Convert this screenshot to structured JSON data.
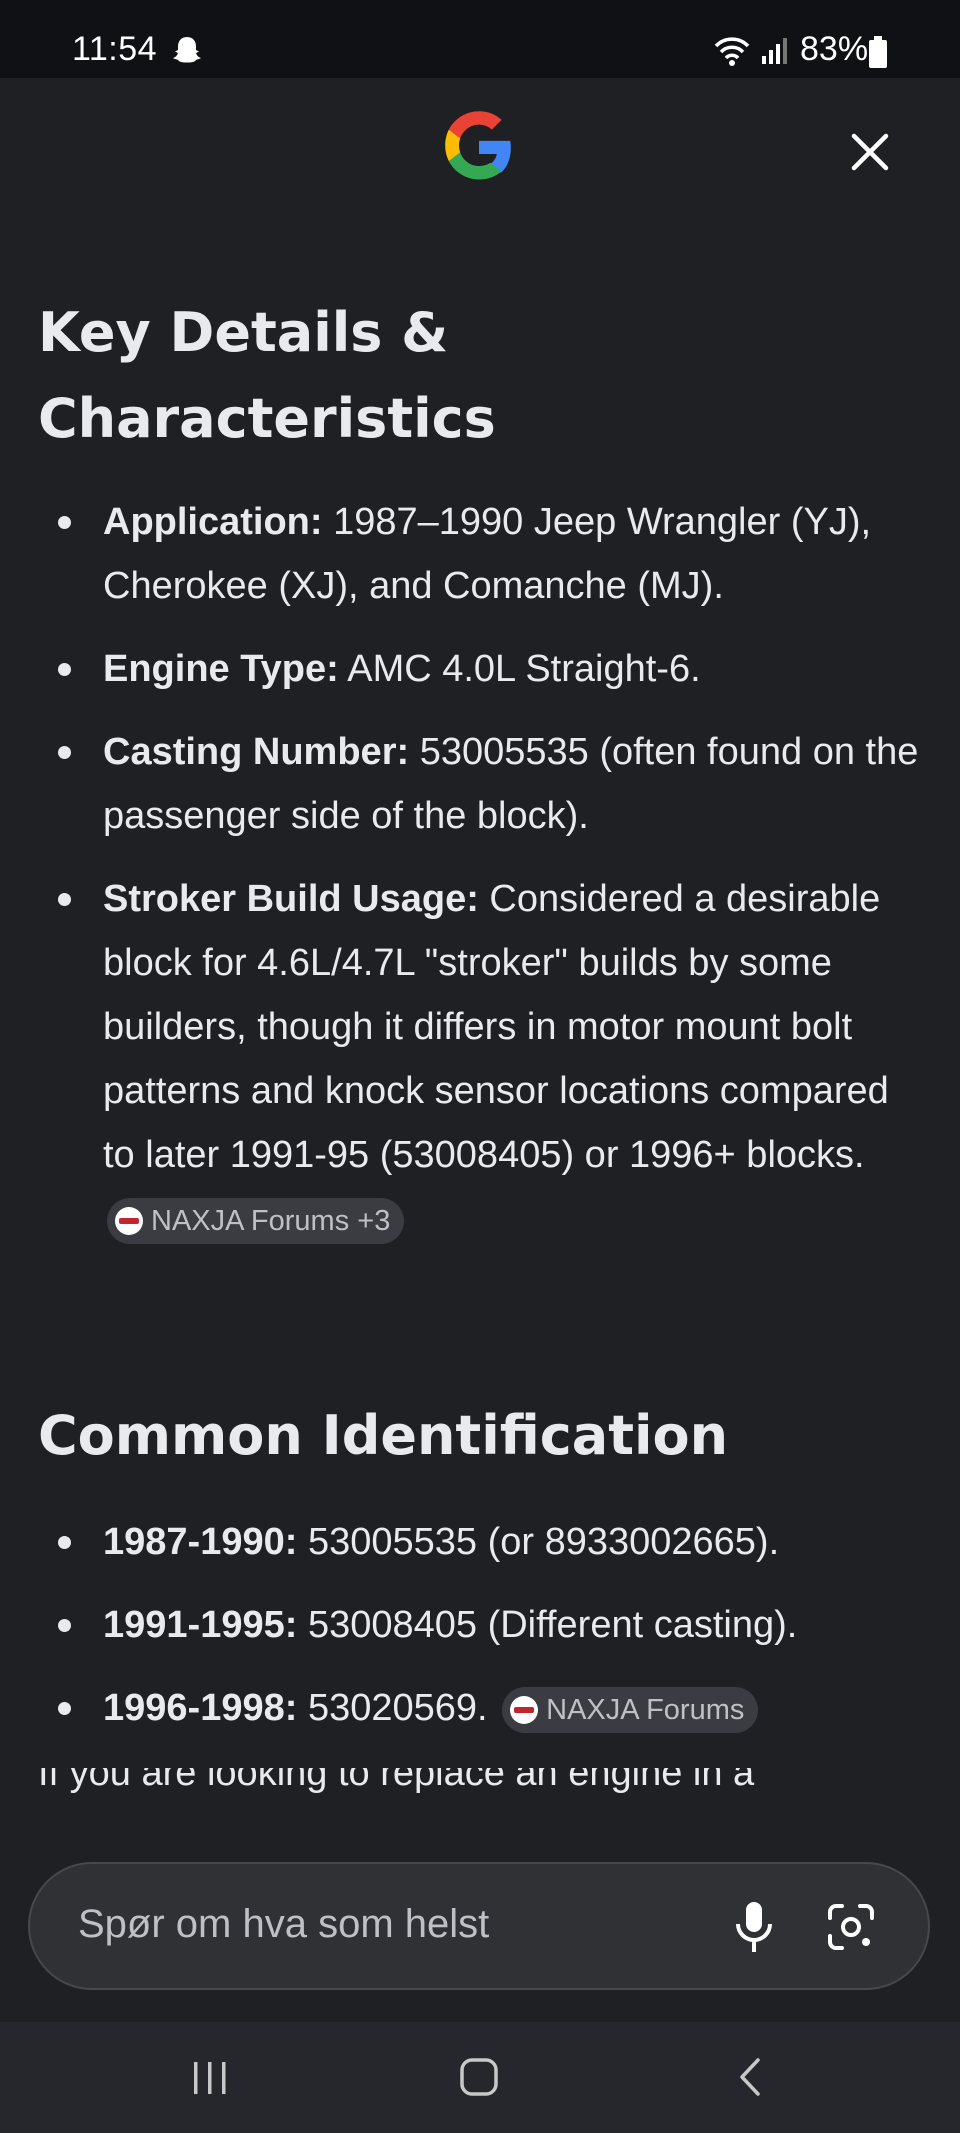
{
  "status_bar": {
    "time": "11:54",
    "battery": "83%",
    "icons": [
      "snapchat-ghost-icon",
      "wifi-icon",
      "signal-icon",
      "battery-icon"
    ]
  },
  "header": {
    "logo": "google-g-logo",
    "close_icon": "close-icon"
  },
  "sections": {
    "key_details": {
      "heading_line1": "Key Details &",
      "heading_line2": "Characteristics",
      "items": [
        {
          "label": "Application:",
          "text": " 1987–1990 Jeep Wrangler (YJ), Cherokee (XJ), and Comanche (MJ)."
        },
        {
          "label": "Engine Type:",
          "text": " AMC 4.0L Straight-6."
        },
        {
          "label": "Casting Number:",
          "text": " 53005535 (often found on the passenger side of the block)."
        },
        {
          "label": "Stroker Build Usage:",
          "text": " Considered a desirable block for 4.6L/4.7L \"stroker\" builds by some builders, though it differs in motor mount bolt patterns and knock sensor locations compared to later 1991-95 (53008405) or 1996+ blocks.",
          "source": "NAXJA Forums +3"
        }
      ]
    },
    "common_identification": {
      "heading": "Common Identification",
      "items": [
        {
          "label": "1987-1990:",
          "text": " 53005535 (or 8933002665)."
        },
        {
          "label": "1991-1995:",
          "text": " 53008405 (Different casting)."
        },
        {
          "label": "1996-1998:",
          "text": " 53020569.",
          "source": "NAXJA Forums"
        }
      ]
    },
    "cut_off_text": "If you are looking to replace an engine in a"
  },
  "search": {
    "placeholder": "Spør om hva som helst",
    "icons": [
      "mic-icon",
      "google-lens-icon"
    ]
  },
  "nav": {
    "icons": [
      "recents-icon",
      "home-icon",
      "back-icon"
    ]
  },
  "colors": {
    "background": "#1f2023",
    "text": "#e8eaed",
    "chip": "#3a3c42",
    "search_bar": "#303134"
  }
}
